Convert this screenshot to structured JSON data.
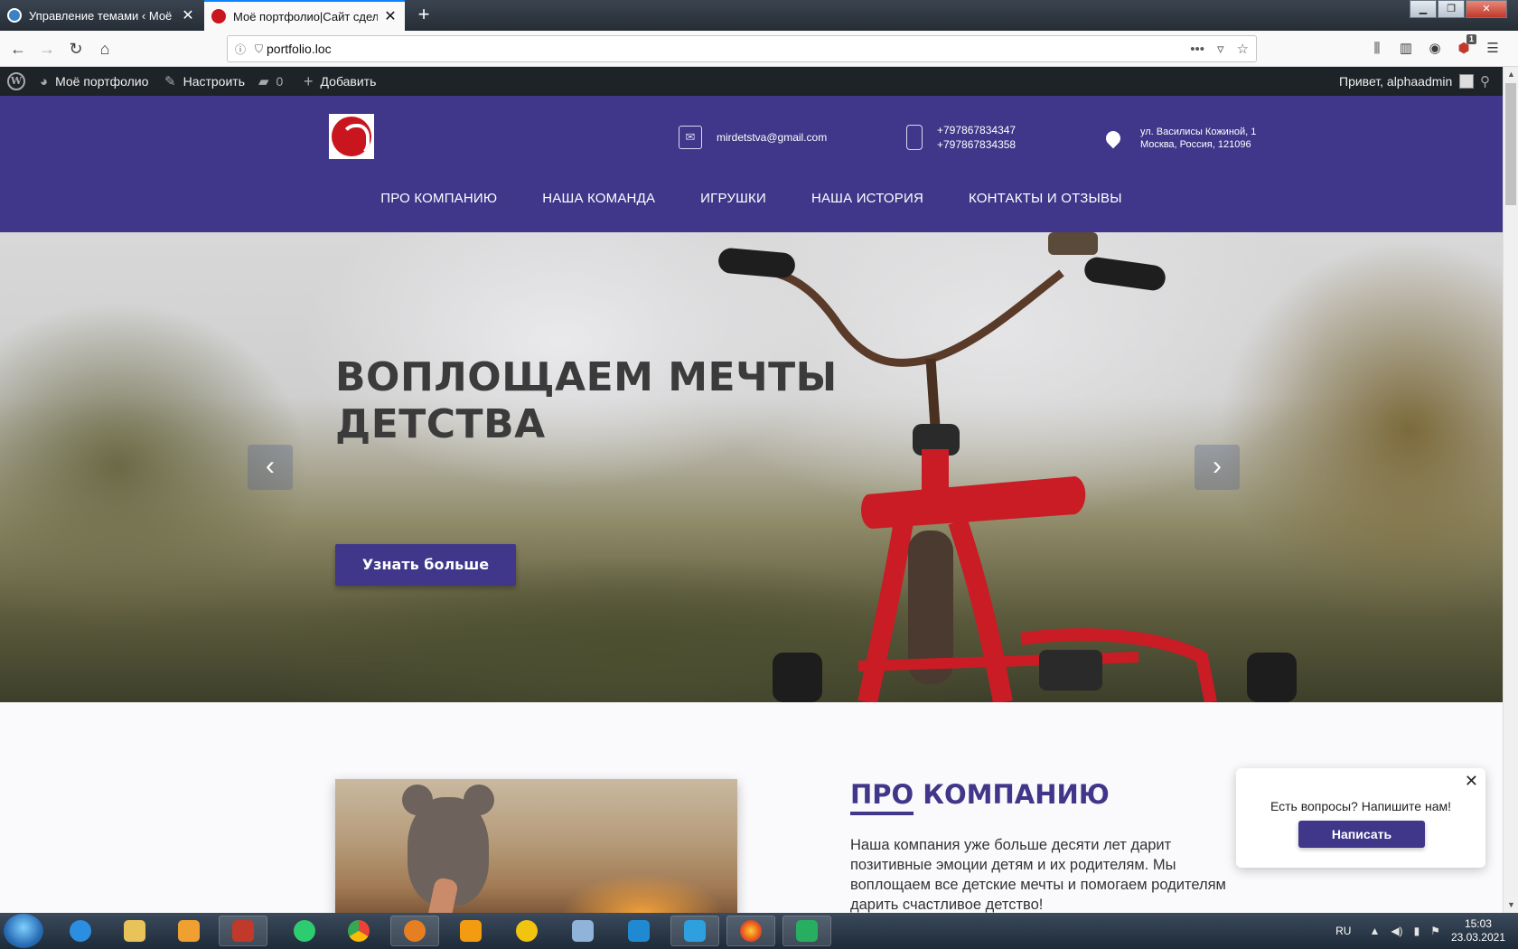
{
  "browser": {
    "tabs": [
      {
        "title": "Управление темами ‹ Моё портфолио",
        "active": false
      },
      {
        "title": "Моё портфолио|Сайт сделан",
        "active": true
      }
    ],
    "url": "portfolio.loc",
    "extension_badge": "1"
  },
  "wp_admin_bar": {
    "site_name": "Моё портфолио",
    "customize": "Настроить",
    "comments_count": "0",
    "add_new": "Добавить",
    "greeting": "Привет, alphaadmin"
  },
  "header": {
    "email": "mirdetstva@gmail.com",
    "phones": [
      "+797867834347",
      "+797867834358"
    ],
    "address": [
      "ул. Василисы Кожиной, 1",
      "Москва, Россия, 121096"
    ],
    "menu": [
      "ПРО КОМПАНИЮ",
      "НАША КОМАНДА",
      "ИГРУШКИ",
      "НАША ИСТОРИЯ",
      "КОНТАКТЫ И ОТЗЫВЫ"
    ]
  },
  "hero": {
    "title_line1": "ВОПЛОЩАЕМ МЕЧТЫ",
    "title_line2": "ДЕТСТВА",
    "button": "Узнать больше"
  },
  "about": {
    "title_underlined": "ПРО",
    "title_rest": " КОМПАНИЮ",
    "text": "Наша компания уже больше десяти лет дарит позитивные эмоции детям и их родителям. Мы воплощаем все детские мечты и помогаем родителям дарить счастливое детство!"
  },
  "chat_popup": {
    "text": "Есть вопросы? Напишите нам!",
    "button": "Написать"
  },
  "taskbar": {
    "language": "RU",
    "time": "15:03",
    "date": "23.03.2021"
  },
  "colors": {
    "brand": "#40368a",
    "admin_bar": "#1d2327"
  }
}
